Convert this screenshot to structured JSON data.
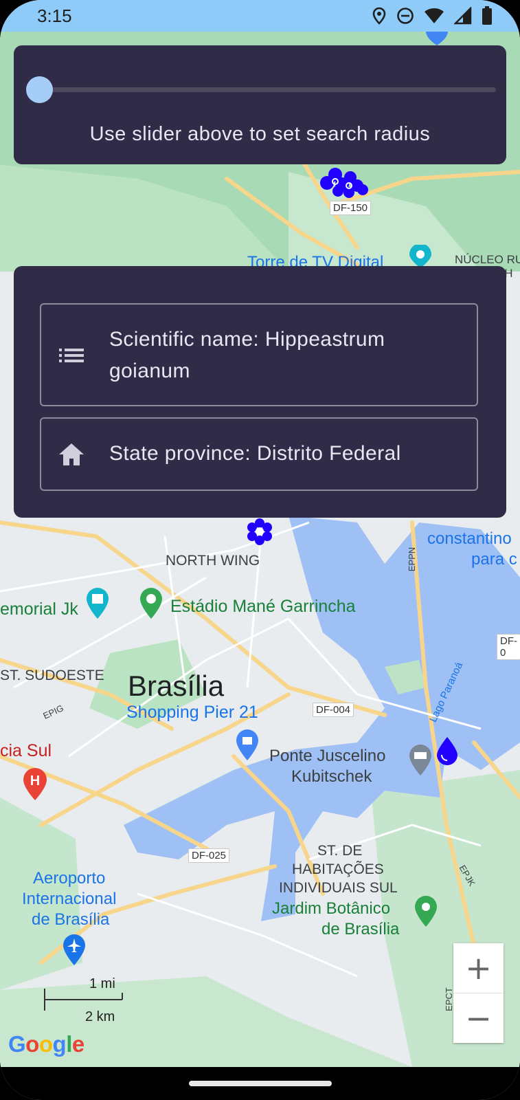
{
  "status_bar": {
    "time": "3:15",
    "icons": [
      "location-icon",
      "do-not-disturb-icon",
      "wifi-icon",
      "signal-icon",
      "battery-icon"
    ]
  },
  "slider": {
    "caption": "Use slider above to set search radius",
    "value": 0
  },
  "info": {
    "scientific_name": "Scientific name: Hippeastrum goianum",
    "state_province": "State province: Distrito Federal"
  },
  "map": {
    "labels": {
      "north_wing": "NORTH WING",
      "memorial": "emorial Jk",
      "estadio": "Estádio Mané Garrincha",
      "st_sudoeste": "ST. SUDOESTE",
      "brasilia": "Brasília",
      "shopping": "Shopping Pier 21",
      "cia_sul": "cia Sul",
      "ponte_1": "Ponte Juscelino",
      "ponte_2": "Kubitschek",
      "st_hab_1": "ST. DE",
      "st_hab_2": "HABITAÇÕES",
      "st_hab_3": "INDIVIDUAIS SUL",
      "jardim_1": "Jardim Botânico",
      "jardim_2": "de Brasília",
      "aeroporto_1": "Aeroporto",
      "aeroporto_2": "Internacional",
      "aeroporto_3": "de Brasília",
      "constantino_1": "constantino",
      "constantino_2": "para c",
      "lago": "Lago Paranoá",
      "nucleo_1": "NÚCLEO RUR",
      "nucleo_2": "NH",
      "tv_partial": "Torre de TV Digital"
    },
    "roads": {
      "df150": "DF-150",
      "df004": "DF-004",
      "df025": "DF-025",
      "df0": "DF-0",
      "epig": "EPIG",
      "eppn": "EPPN",
      "epjk": "EPJK",
      "epct": "EPCT"
    },
    "scale": {
      "miles": "1 mi",
      "km": "2 km"
    },
    "zoom": {
      "in": "+",
      "out": "−"
    },
    "attribution": "Google",
    "colors": {
      "marker": "#2200ff",
      "land": "#e9ecee",
      "park": "#c5e8c5",
      "water": "#9fc0f5",
      "road": "#f7d58b"
    }
  }
}
